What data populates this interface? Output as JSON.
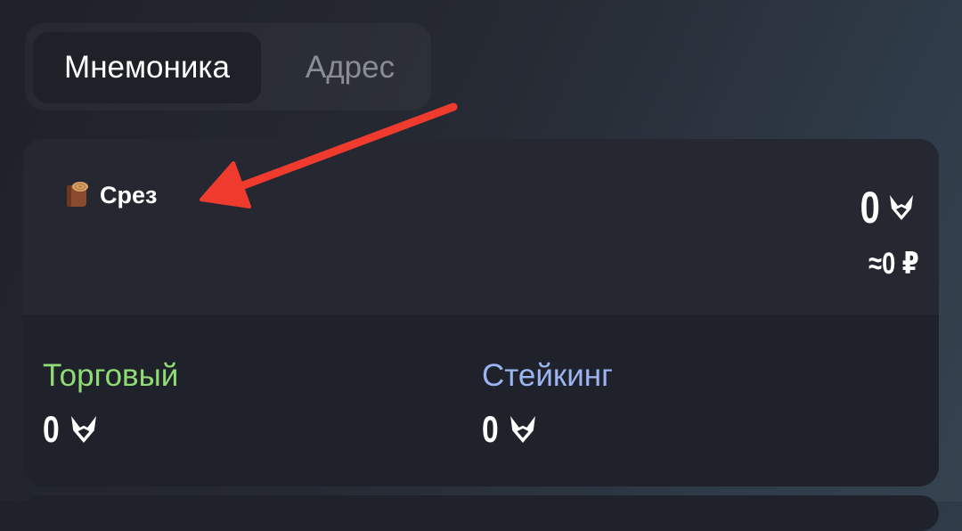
{
  "tabs": [
    {
      "label": "Мнемоника",
      "active": true
    },
    {
      "label": "Адрес",
      "active": false
    }
  ],
  "wallet": {
    "emoji_icon": "log-icon",
    "name": "Срез",
    "balance": "0",
    "currency_icon": "fox-icon",
    "fiat_balance": "≈0 ₽"
  },
  "sub_balances": [
    {
      "label": "Торговый",
      "value": "0",
      "color": "#8fdc74"
    },
    {
      "label": "Стейкинг",
      "value": "0",
      "color": "#9bb5f3"
    }
  ],
  "colors": {
    "annotation_arrow": "#ef3b2d",
    "card_background": "#20222b"
  }
}
